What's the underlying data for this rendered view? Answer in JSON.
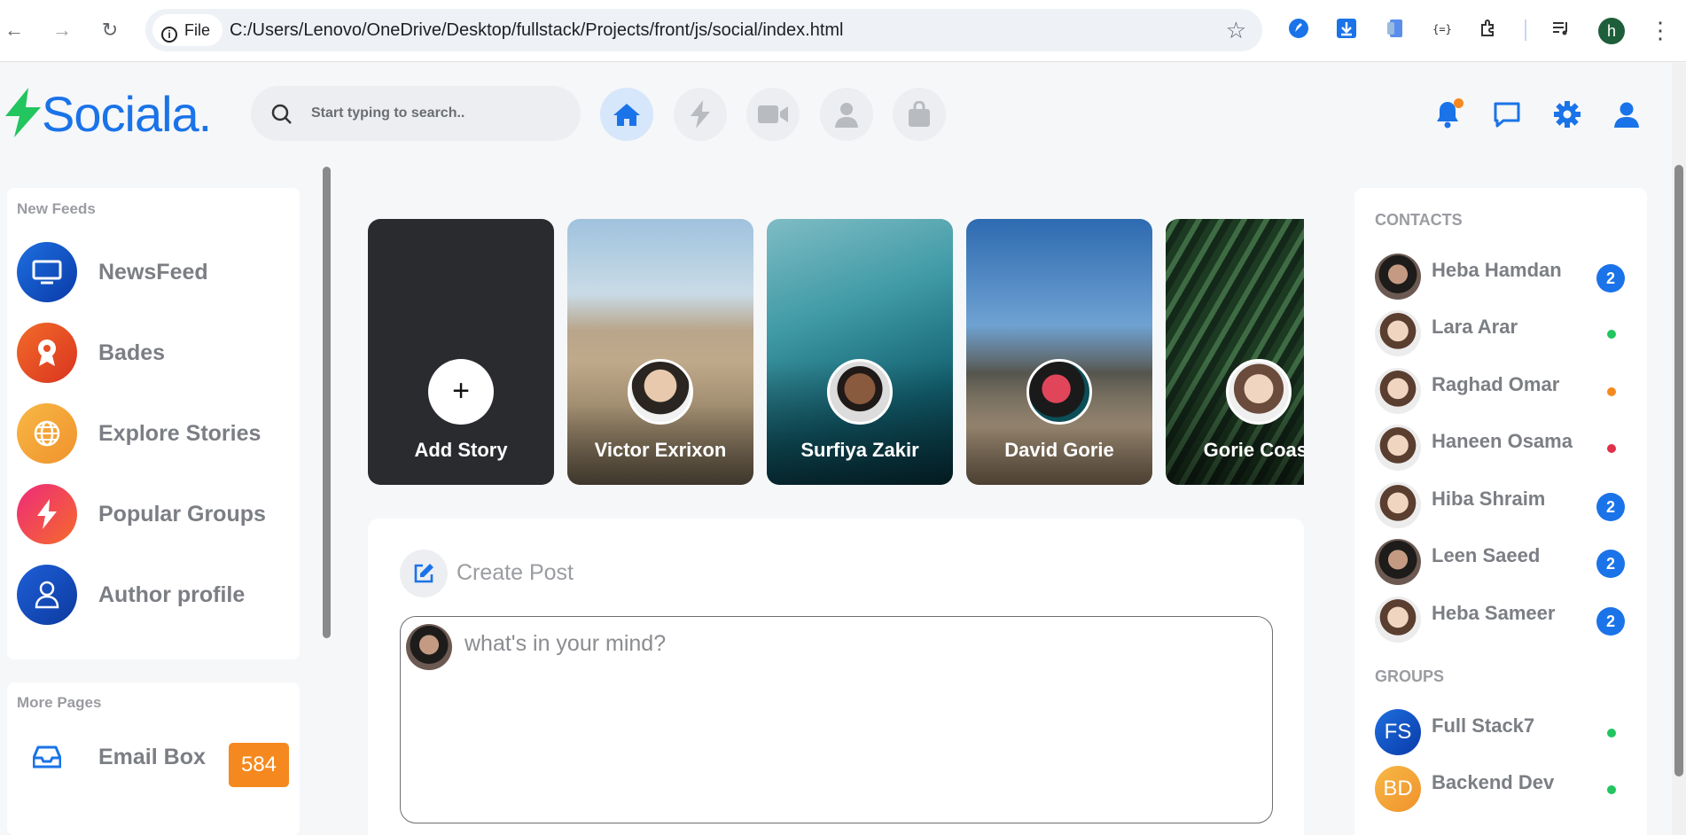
{
  "browser": {
    "file_label": "File",
    "url": "C:/Users/Lenovo/OneDrive/Desktop/fullstack/Projects/front/js/social/index.html",
    "profile_initial": "h"
  },
  "header": {
    "logo": "Sociala.",
    "search_placeholder": "Start typing to search.."
  },
  "left_nav": {
    "section1_title": "New Feeds",
    "items": [
      {
        "label": "NewsFeed",
        "icon": "tv-icon"
      },
      {
        "label": "Bades",
        "icon": "award-icon"
      },
      {
        "label": "Explore Stories",
        "icon": "globe-icon"
      },
      {
        "label": "Popular Groups",
        "icon": "lightning-icon"
      },
      {
        "label": "Author profile",
        "icon": "user-icon"
      }
    ],
    "section2_title": "More Pages",
    "more_items": [
      {
        "label": "Email Box",
        "badge": "584",
        "icon": "inbox-icon"
      }
    ]
  },
  "stories": [
    {
      "name": "Add Story"
    },
    {
      "name": "Victor Exrixon"
    },
    {
      "name": "Surfiya Zakir"
    },
    {
      "name": "David Gorie"
    },
    {
      "name": "Gorie Coast"
    }
  ],
  "create_post": {
    "title": "Create Post",
    "placeholder": "what's in your mind?"
  },
  "contacts": {
    "title": "CONTACTS",
    "items": [
      {
        "name": "Heba Hamdan",
        "badge": "2"
      },
      {
        "name": "Lara Arar",
        "status_color": "#22c55e"
      },
      {
        "name": "Raghad Omar",
        "status_color": "#f5891f"
      },
      {
        "name": "Haneen Osama",
        "status_color": "#e0314b"
      },
      {
        "name": "Hiba Shraim",
        "badge": "2"
      },
      {
        "name": "Leen Saeed",
        "badge": "2"
      },
      {
        "name": "Heba Sameer",
        "badge": "2"
      }
    ]
  },
  "groups": {
    "title": "GROUPS",
    "items": [
      {
        "initials": "FS",
        "name": "Full Stack7",
        "status_color": "#22c55e"
      },
      {
        "initials": "BD",
        "name": "Backend Dev",
        "status_color": "#22c55e"
      }
    ]
  },
  "colors": {
    "accent": "#1a73e8",
    "orange": "#f5891f",
    "logo_green": "#22c55e"
  }
}
